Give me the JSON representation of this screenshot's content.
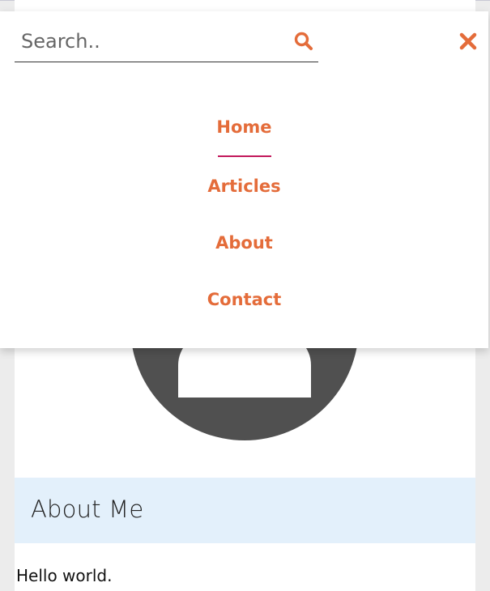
{
  "search": {
    "placeholder": "Search.."
  },
  "nav": {
    "items": [
      {
        "label": "Home",
        "active": true
      },
      {
        "label": "Articles",
        "active": false
      },
      {
        "label": "About",
        "active": false
      },
      {
        "label": "Contact",
        "active": false
      }
    ]
  },
  "about": {
    "title": "About Me",
    "text": "Hello world."
  },
  "colors": {
    "accent": "#e46c3a",
    "active_underline": "#c2185b",
    "avatar": "#505050",
    "about_header_bg": "#e3f0fb"
  },
  "icons": {
    "search": "search-icon",
    "close": "close-icon",
    "avatar": "user-avatar-icon"
  }
}
